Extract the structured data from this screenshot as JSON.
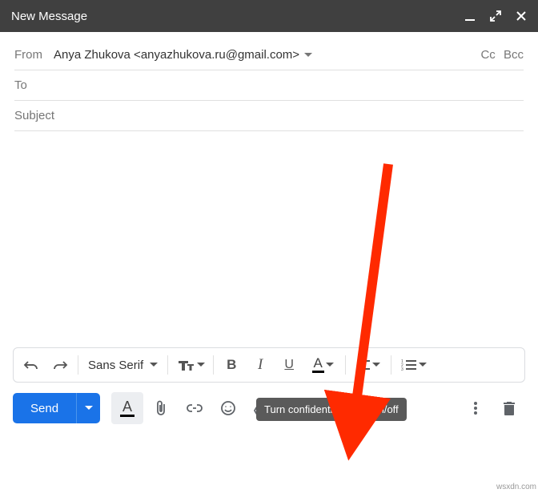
{
  "header": {
    "title": "New Message"
  },
  "from": {
    "label": "From",
    "value": "Anya Zhukova <anyazhukova.ru@gmail.com>",
    "cc": "Cc",
    "bcc": "Bcc"
  },
  "to": {
    "label": "To"
  },
  "subject": {
    "placeholder": "Subject"
  },
  "format": {
    "font": "Sans Serif",
    "bold": "B",
    "italic": "I",
    "underline": "U"
  },
  "send": {
    "label": "Send"
  },
  "format_A": "A",
  "tooltip": "Turn confidential mode on/off",
  "watermark": "wsxdn.com"
}
